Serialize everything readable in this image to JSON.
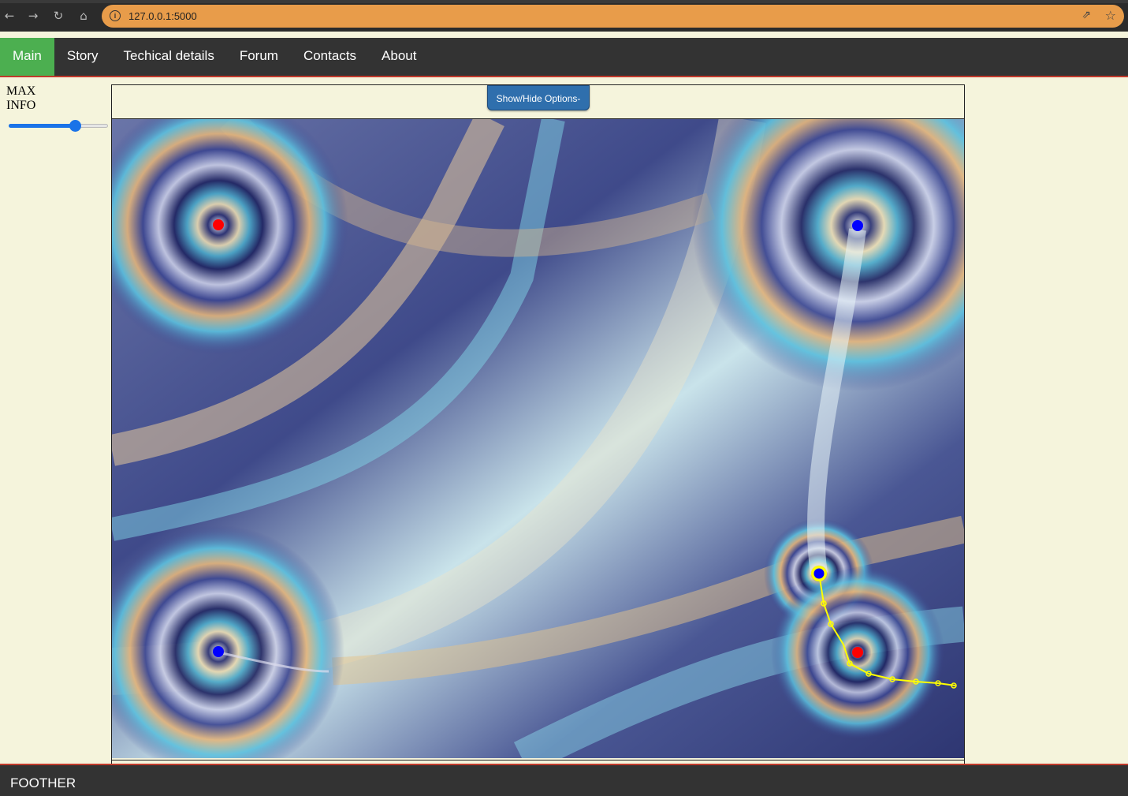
{
  "browser": {
    "url": "127.0.0.1:5000",
    "back_icon": "←",
    "forward_icon": "→",
    "reload_icon": "↻",
    "home_icon": "⌂",
    "info_icon": "i",
    "share_icon": "⇗",
    "star_icon": "☆"
  },
  "nav": {
    "items": [
      {
        "label": "Main",
        "active": true
      },
      {
        "label": "Story"
      },
      {
        "label": "Techical details"
      },
      {
        "label": "Forum"
      },
      {
        "label": "Contacts"
      },
      {
        "label": "About"
      }
    ]
  },
  "sidebar": {
    "label_line1": "MAX",
    "label_line2": "INFO",
    "slider_value_fraction": 0.66
  },
  "options": {
    "button_label": "Show/Hide Options-"
  },
  "field": {
    "charges": [
      {
        "color": "#ff0000",
        "type": "positive"
      },
      {
        "color": "#0000ff",
        "type": "negative"
      },
      {
        "color": "#0000ff",
        "type": "negative"
      },
      {
        "color": "#0000ff",
        "type": "negative",
        "selected": true
      },
      {
        "color": "#ff0000",
        "type": "positive"
      }
    ],
    "trajectory_color": "#ffff00"
  },
  "footer": {
    "text": "FOOTHER"
  },
  "colors": {
    "nav_bg": "#333333",
    "nav_active": "#4caf50",
    "accent_line": "#c0392b",
    "page_bg": "#f5f4dc",
    "button_bg": "#2f6fad"
  }
}
